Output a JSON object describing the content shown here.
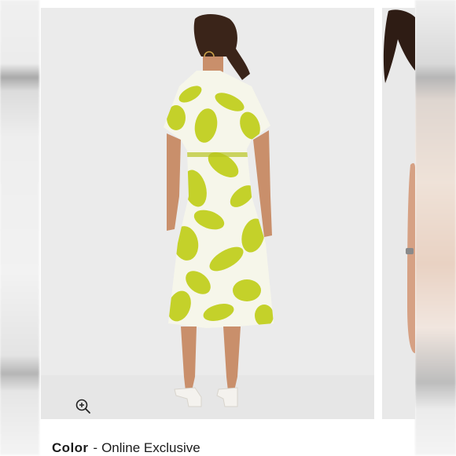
{
  "product": {
    "main_image": {
      "alt": "Model wearing yellow-green floral print midi shirt dress, back view"
    },
    "next_image": {
      "alt": "Model close-up, partially visible"
    },
    "zoom_icon": "zoom-in-icon"
  },
  "color": {
    "label": "Color",
    "separator": "-",
    "value": "Online Exclusive"
  },
  "colors": {
    "print_primary": "#c4d12a",
    "print_secondary": "#f6f6ea",
    "background": "#ebebeb",
    "text": "#1b1b1b"
  }
}
